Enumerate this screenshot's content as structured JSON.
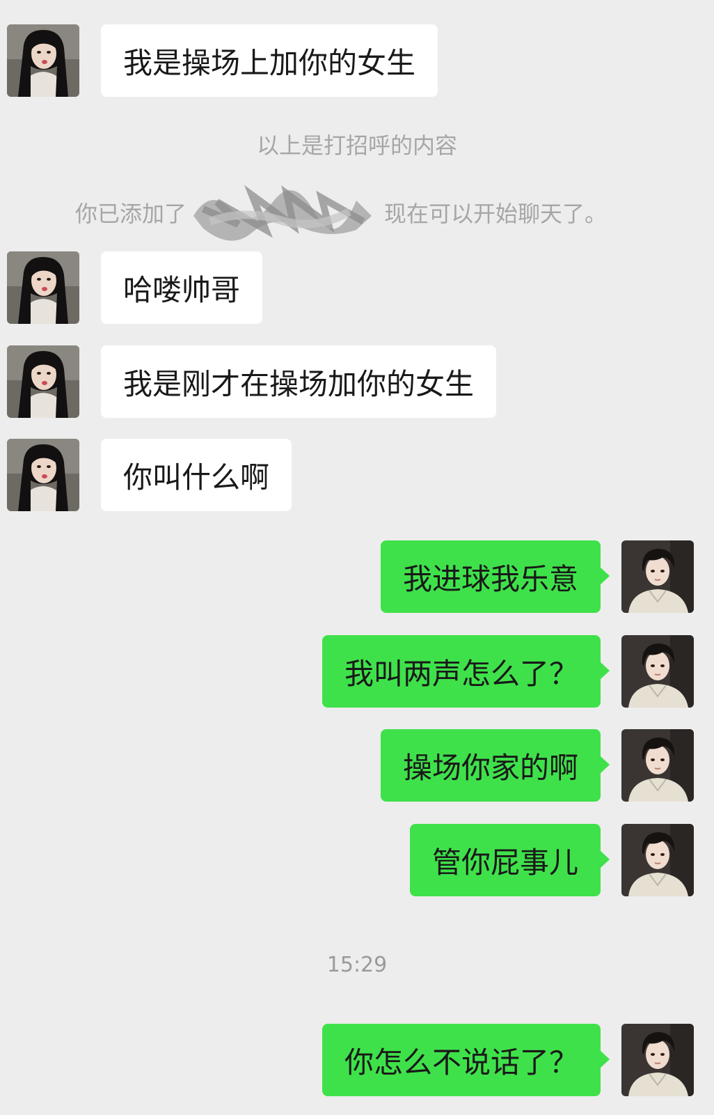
{
  "messages": [
    {
      "side": "in",
      "text": "我是操场上加你的女生"
    },
    {
      "side": "in",
      "text": "哈喽帅哥"
    },
    {
      "side": "in",
      "text": "我是刚才在操场加你的女生"
    },
    {
      "side": "in",
      "text": "你叫什么啊"
    },
    {
      "side": "out",
      "text": "我进球我乐意"
    },
    {
      "side": "out",
      "text": "我叫两声怎么了？"
    },
    {
      "side": "out",
      "text": "操场你家的啊"
    },
    {
      "side": "out",
      "text": "管你屁事儿"
    },
    {
      "side": "out",
      "text": "你怎么不说话了？"
    }
  ],
  "system": {
    "greeting_note": "以上是打招呼的内容",
    "added_prefix": "你已添加了",
    "added_suffix": "现在可以开始聊天了。"
  },
  "timestamp": "15:29",
  "colors": {
    "background": "#ededed",
    "incoming_bubble": "#ffffff",
    "outgoing_bubble": "#3fe14a",
    "system_text": "#a6a6a6"
  },
  "icons": {
    "incoming_avatar": "female-avatar-icon",
    "outgoing_avatar": "male-avatar-icon",
    "redaction": "scribble-redaction"
  }
}
